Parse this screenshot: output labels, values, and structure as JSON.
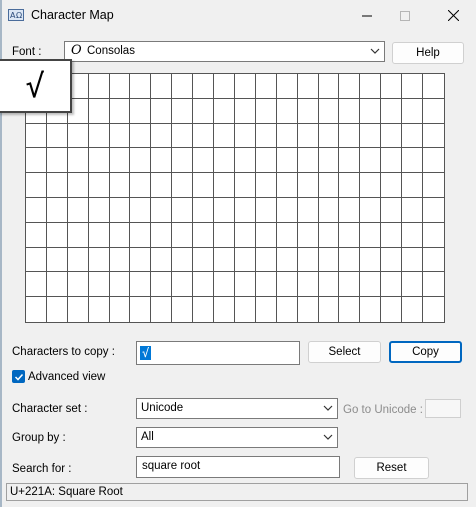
{
  "window": {
    "title": "Character Map"
  },
  "font": {
    "label": "Font :",
    "value": "Consolas",
    "glyph": "O"
  },
  "buttons": {
    "help": "Help",
    "select": "Select",
    "copy": "Copy",
    "reset": "Reset"
  },
  "zoom": {
    "char": "√"
  },
  "copy": {
    "label": "Characters to copy :",
    "value": "√"
  },
  "advanced": {
    "label": "Advanced view",
    "checked": true
  },
  "charset": {
    "label": "Character set :",
    "value": "Unicode"
  },
  "goto": {
    "label": "Go to Unicode :"
  },
  "groupby": {
    "label": "Group by :",
    "value": "All"
  },
  "search": {
    "label": "Search for :",
    "value": "square root"
  },
  "status": {
    "text": "U+221A: Square Root"
  },
  "colors": {
    "accent": "#0067c0",
    "selection": "#0078d7"
  }
}
